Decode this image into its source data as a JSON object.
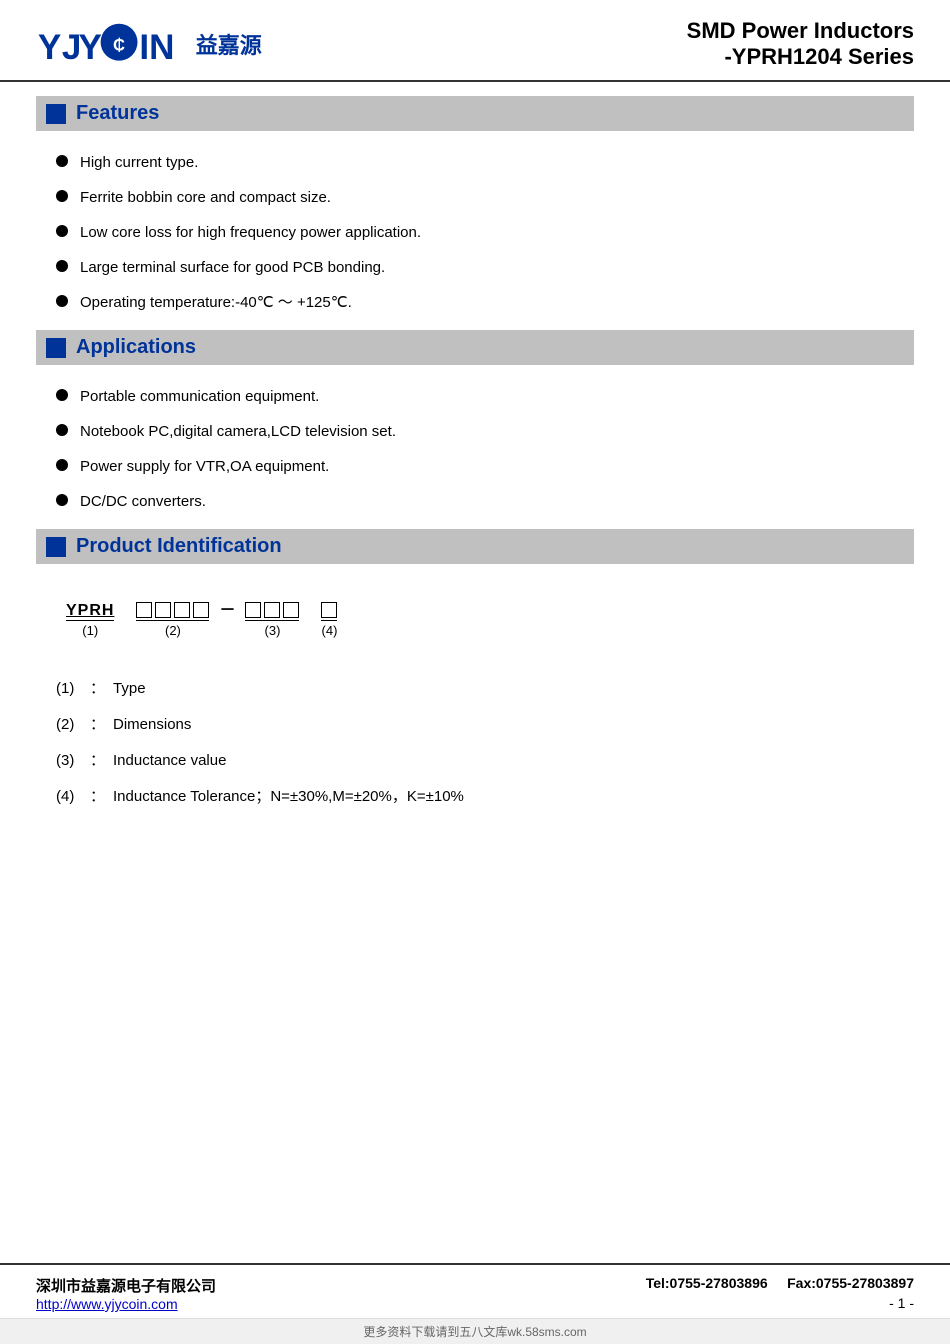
{
  "header": {
    "logo_text_en": "YJYCOIN",
    "logo_text_cn": "益嘉源",
    "title_line1": "SMD Power Inductors",
    "title_line2": "-YPRH1204 Series"
  },
  "sections": {
    "features": {
      "label": "Features",
      "items": [
        "High current type.",
        "Ferrite bobbin core and compact size.",
        "Low core loss for high frequency power application.",
        "Large terminal surface for good PCB bonding.",
        "Operating temperature:-40℃ ～ +125℃."
      ]
    },
    "applications": {
      "label": "Applications",
      "items": [
        "Portable communication equipment.",
        "Notebook PC,digital camera,LCD television set.",
        "Power supply for VTR,OA equipment.",
        "DC/DC converters."
      ]
    },
    "product_identification": {
      "label": "Product Identification",
      "diagram_prefix": "YPRH",
      "diagram_label1": "(1)",
      "diagram_label2": "(2)",
      "diagram_label3": "(3)",
      "diagram_label4": "(4)",
      "details": [
        {
          "num": "(1)",
          "colon": "：",
          "desc": "Type"
        },
        {
          "num": "(2)",
          "colon": "：",
          "desc": "Dimensions"
        },
        {
          "num": "(3)",
          "colon": "：",
          "desc": "Inductance value"
        },
        {
          "num": "(4)",
          "colon": "：",
          "desc": "Inductance Tolerance；N=±30%,M=±20%，K=±10%"
        }
      ]
    }
  },
  "footer": {
    "company": "深圳市益嘉源电子有限公司",
    "url": "http://www.yjycoin.com",
    "tel": "Tel:0755-27803896",
    "fax": "Fax:0755-27803897",
    "page": "- 1 -",
    "watermark": "更多资料下载请到五八文库wk.58sms.com"
  }
}
